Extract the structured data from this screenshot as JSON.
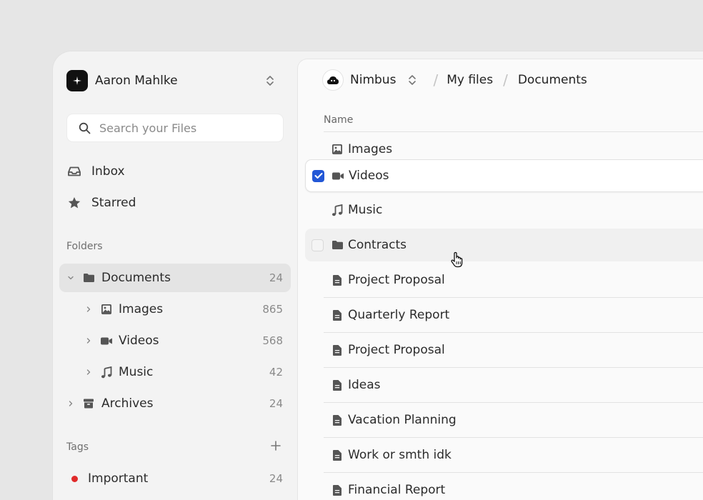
{
  "sidebar": {
    "account": {
      "name": "Aaron Mahlke",
      "logo_icon": "plus-sparkle-icon"
    },
    "search": {
      "placeholder": "Search your Files",
      "value": ""
    },
    "nav": [
      {
        "label": "Inbox",
        "icon": "inbox-icon"
      },
      {
        "label": "Starred",
        "icon": "star-icon"
      }
    ],
    "folders_title": "Folders",
    "folders": [
      {
        "label": "Documents",
        "count": "24",
        "icon": "folder-icon",
        "expanded": true,
        "active": true
      },
      {
        "label": "Images",
        "count": "865",
        "icon": "image-icon"
      },
      {
        "label": "Videos",
        "count": "568",
        "icon": "video-icon"
      },
      {
        "label": "Music",
        "count": "42",
        "icon": "music-icon"
      },
      {
        "label": "Archives",
        "count": "24",
        "icon": "archive-icon"
      }
    ],
    "tags_title": "Tags",
    "tags": [
      {
        "label": "Important",
        "count": "24",
        "color": "#e02a2a"
      }
    ]
  },
  "main": {
    "workspace": {
      "name": "Nimbus",
      "logo_icon": "cloud-logo-icon"
    },
    "breadcrumb": [
      "My files",
      "Documents"
    ],
    "column_name": "Name",
    "files": [
      {
        "label": "Images",
        "icon": "image-icon",
        "state": "normal"
      },
      {
        "label": "Videos",
        "icon": "video-icon",
        "state": "selected",
        "checked": true
      },
      {
        "label": "Music",
        "icon": "music-icon",
        "state": "normal"
      },
      {
        "label": "Contracts",
        "icon": "folder-icon",
        "state": "hover",
        "checked": false
      },
      {
        "label": "Project Proposal",
        "icon": "document-icon",
        "state": "normal"
      },
      {
        "label": "Quarterly Report",
        "icon": "document-icon",
        "state": "normal"
      },
      {
        "label": "Project Proposal",
        "icon": "document-icon",
        "state": "normal"
      },
      {
        "label": "Ideas",
        "icon": "document-icon",
        "state": "normal"
      },
      {
        "label": "Vacation Planning",
        "icon": "document-icon",
        "state": "normal"
      },
      {
        "label": "Work or smth idk",
        "icon": "document-icon",
        "state": "normal"
      },
      {
        "label": "Financial Report",
        "icon": "document-icon",
        "state": "normal"
      }
    ]
  },
  "colors": {
    "accent": "#2257d6",
    "tag_important": "#e02a2a",
    "icon": "#555555"
  }
}
